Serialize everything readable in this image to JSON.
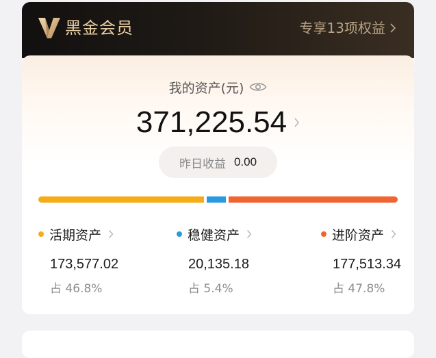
{
  "header": {
    "brand": "黑金会员",
    "link_label": "专享13项权益",
    "accent_color": "#e9cfa2",
    "icons": {
      "logo": "v-logo-icon",
      "link_arrow": "chevron-right-icon"
    }
  },
  "assets": {
    "label": "我的资产(元)",
    "eye_icon": "eye-icon",
    "total": "371,225.54",
    "yesterday_label": "昨日收益",
    "yesterday_value": "0.00"
  },
  "distribution": {
    "segments": [
      {
        "name": "活期资产",
        "ratio": 0.468,
        "color": "#f4ac17"
      },
      {
        "name": "稳健资产",
        "ratio": 0.054,
        "color": "#2a9ae0"
      },
      {
        "name": "进阶资产",
        "ratio": 0.478,
        "color": "#f0642f"
      }
    ]
  },
  "categories": [
    {
      "title": "活期资产",
      "value": "173,577.02",
      "ratio": "占 46.8%",
      "color": "#f4ac17"
    },
    {
      "title": "稳健资产",
      "value": "20,135.18",
      "ratio": "占 5.4%",
      "color": "#2a9ae0"
    },
    {
      "title": "进阶资产",
      "value": "177,513.34",
      "ratio": "占 47.8%",
      "color": "#f0642f"
    }
  ]
}
